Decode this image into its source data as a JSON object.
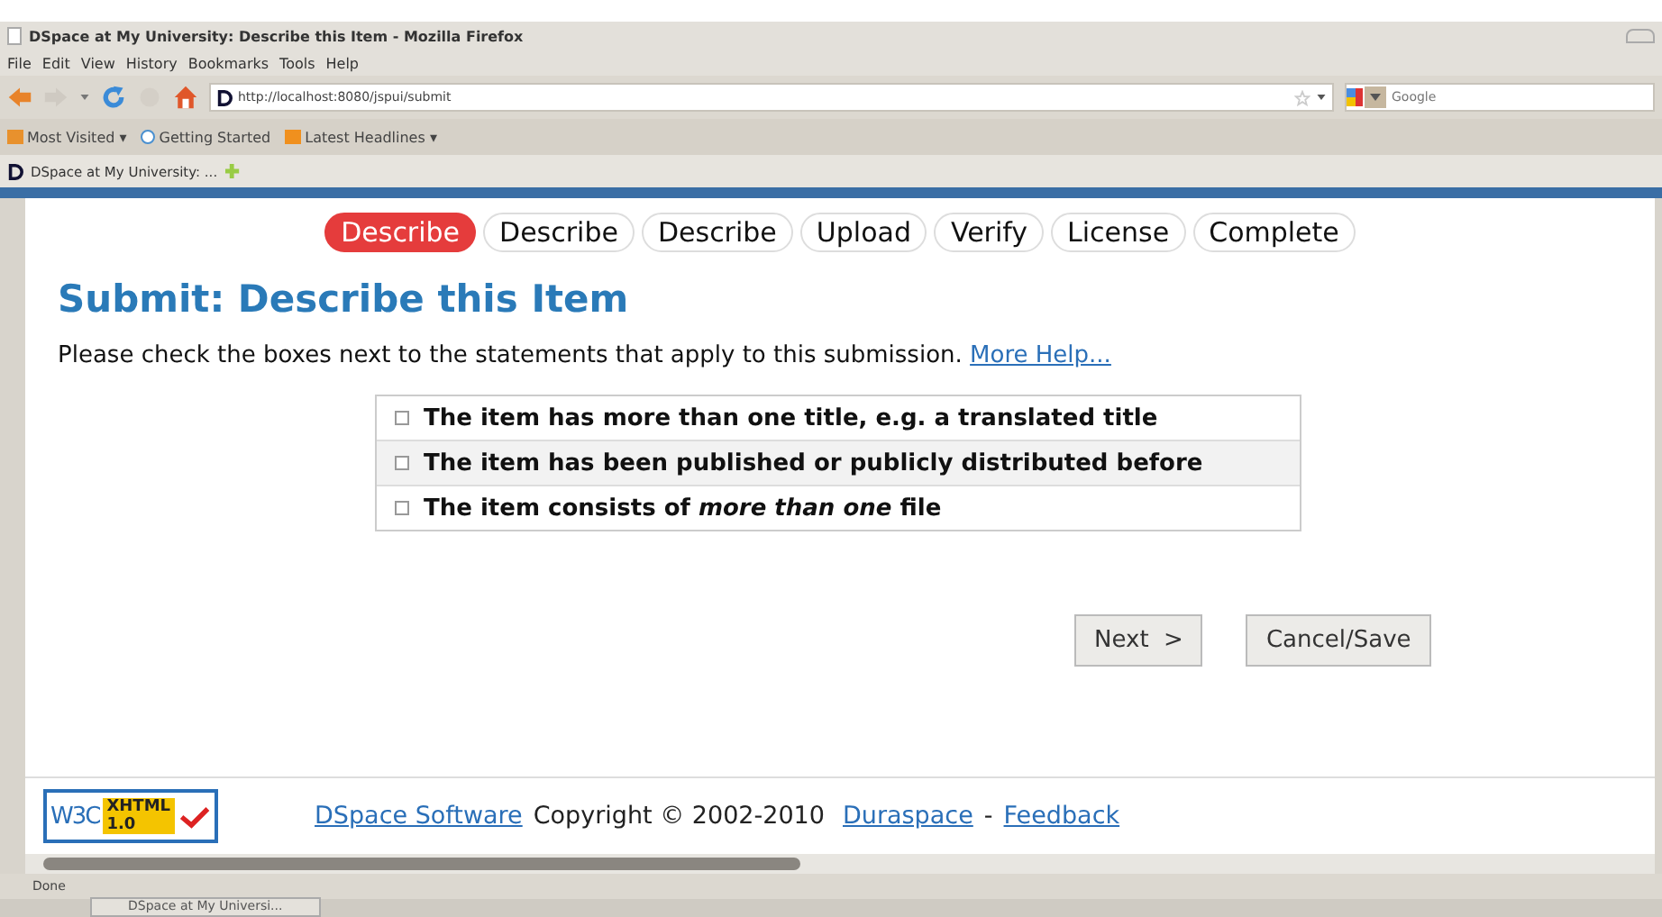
{
  "window": {
    "title": "DSpace at My University: Describe this Item - Mozilla Firefox"
  },
  "menu": [
    "File",
    "Edit",
    "View",
    "History",
    "Bookmarks",
    "Tools",
    "Help"
  ],
  "address": {
    "value": "http://localhost:8080/jspui/submit"
  },
  "search": {
    "placeholder": "Google"
  },
  "bookmarks": [
    {
      "label": "Most Visited ▾",
      "kind": "folder"
    },
    {
      "label": "Getting Started",
      "kind": "page"
    },
    {
      "label": "Latest Headlines ▾",
      "kind": "feed"
    }
  ],
  "browser_tab": {
    "label": "DSpace at My University: ..."
  },
  "steps": [
    {
      "label": "Describe",
      "selected": true
    },
    {
      "label": "Describe",
      "selected": false
    },
    {
      "label": "Describe",
      "selected": false
    },
    {
      "label": "Upload",
      "selected": false
    },
    {
      "label": "Verify",
      "selected": false
    },
    {
      "label": "License",
      "selected": false
    },
    {
      "label": "Complete",
      "selected": false
    }
  ],
  "heading": "Submit: Describe this Item",
  "intro": "Please check the boxes next to the statements that apply to this submission.",
  "help_link": "More Help...",
  "options": [
    {
      "label": "The item has more than one title, e.g. a translated title",
      "checked": false
    },
    {
      "label": "The item has been published or publicly distributed before",
      "checked": false
    },
    {
      "label": "The item consists of *more than one* file",
      "checked": false
    }
  ],
  "buttons": [
    "Next  >",
    "Cancel/Save"
  ],
  "footer": {
    "badge": [
      "W3C",
      "XHTML",
      "1.0"
    ],
    "software_link": "DSpace Software",
    "copyright": "Copyright © 2002-2010",
    "duraspace_link": "Duraspace",
    "separator": "-",
    "feedback_link": "Feedback"
  },
  "status_bar": "Done",
  "taskbar": {
    "item": "DSpace at My Universi..."
  }
}
